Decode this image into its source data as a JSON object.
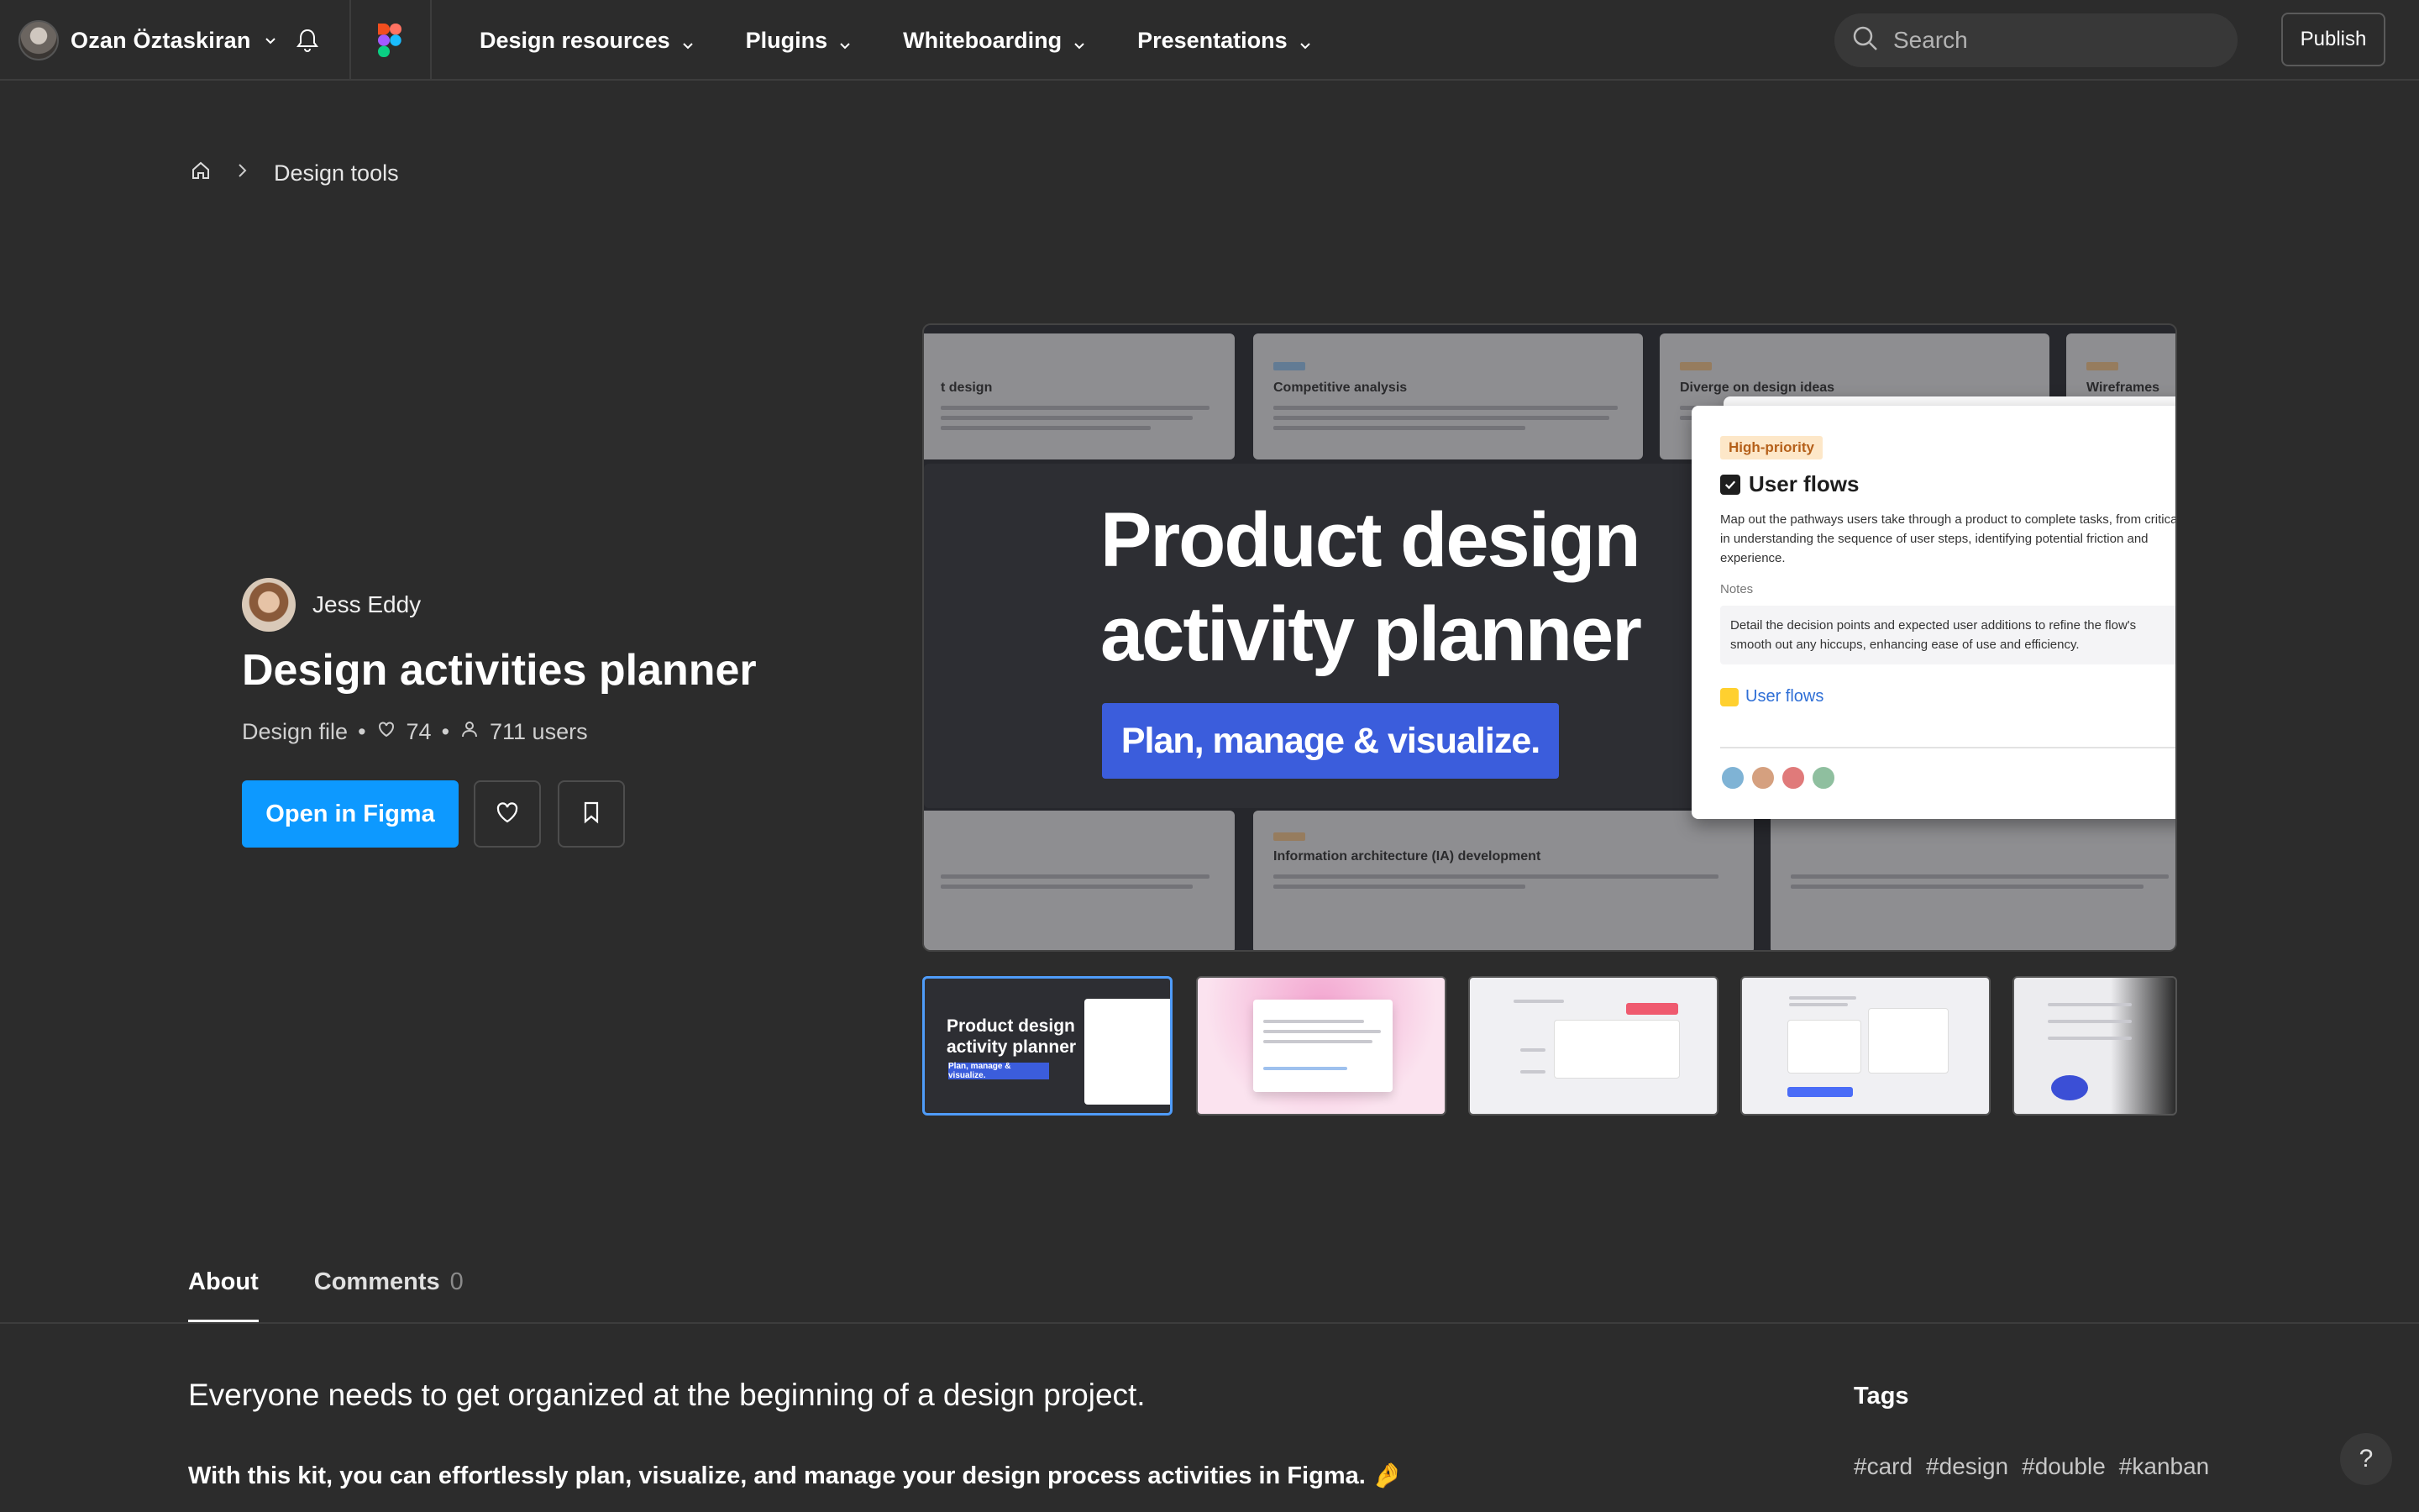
{
  "topbar": {
    "user_name": "Ozan Öztaskiran",
    "nav": [
      {
        "label": "Design resources"
      },
      {
        "label": "Plugins"
      },
      {
        "label": "Whiteboarding"
      },
      {
        "label": "Presentations"
      }
    ],
    "search_placeholder": "Search",
    "publish_label": "Publish"
  },
  "breadcrumb": {
    "item": "Design tools"
  },
  "file": {
    "author": "Jess Eddy",
    "title": "Design activities planner",
    "type": "Design file",
    "likes": "74",
    "users": "711 users",
    "open_label": "Open in Figma"
  },
  "preview": {
    "hero_title_line1": "Product design",
    "hero_title_line2": "activity planner",
    "hero_subtitle": "Plan, manage & visualize.",
    "bg_cards": [
      "Competitive analysis",
      "Diverge on design ideas",
      "Information architecture (IA) development",
      "Wireframes"
    ],
    "card": {
      "badge": "High-priority",
      "title": "User flows",
      "description": "Map out the pathways users take through a product to complete tasks, from critical in understanding the sequence of user steps, identifying potential friction and experience.",
      "notes_label": "Notes",
      "notes": "Detail the decision points and expected user additions to refine the flow's smooth out any hiccups, enhancing ease of use and efficiency.",
      "link": "User flows"
    },
    "thumb1_title": "Product design activity planner",
    "thumb1_sub": "Plan, manage & visualize."
  },
  "tabs": [
    {
      "label": "About",
      "count": ""
    },
    {
      "label": "Comments",
      "count": "0"
    }
  ],
  "about": {
    "lead": "Everyone needs to get organized at the beginning of a design project.",
    "para": "With this kit, you can effortlessly plan, visualize, and manage your design process activities in Figma. 🤌"
  },
  "tags": {
    "title": "Tags",
    "items": [
      "#card",
      "#design",
      "#double",
      "#kanban"
    ]
  },
  "help_label": "?",
  "colors": {
    "accent": "#0d99ff",
    "background": "#2c2c2c",
    "hero_banner": "#3b5ddc"
  }
}
